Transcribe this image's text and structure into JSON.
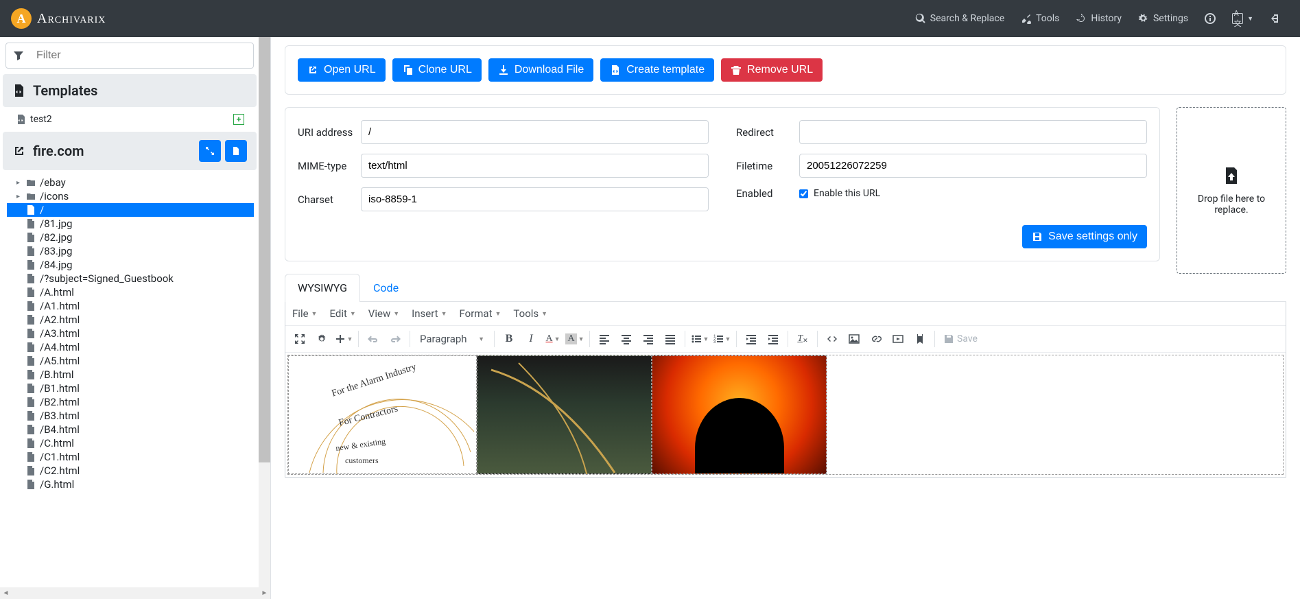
{
  "brand": {
    "name": "Archivarix",
    "logo_letter": "A"
  },
  "nav": {
    "search": "Search & Replace",
    "tools": "Tools",
    "history": "History",
    "settings": "Settings"
  },
  "sidebar": {
    "filter_placeholder": "Filter",
    "templates_header": "Templates",
    "template_items": [
      "test2"
    ],
    "site_header": "fire.com",
    "tree": [
      {
        "type": "folder",
        "label": "/ebay",
        "caret": true
      },
      {
        "type": "folder",
        "label": "/icons",
        "caret": true
      },
      {
        "type": "file",
        "label": "/",
        "selected": true
      },
      {
        "type": "file",
        "label": "/81.jpg"
      },
      {
        "type": "file",
        "label": "/82.jpg"
      },
      {
        "type": "file",
        "label": "/83.jpg"
      },
      {
        "type": "file",
        "label": "/84.jpg"
      },
      {
        "type": "file",
        "label": "/?subject=Signed_Guestbook"
      },
      {
        "type": "file",
        "label": "/A.html"
      },
      {
        "type": "file",
        "label": "/A1.html"
      },
      {
        "type": "file",
        "label": "/A2.html"
      },
      {
        "type": "file",
        "label": "/A3.html"
      },
      {
        "type": "file",
        "label": "/A4.html"
      },
      {
        "type": "file",
        "label": "/A5.html"
      },
      {
        "type": "file",
        "label": "/B.html"
      },
      {
        "type": "file",
        "label": "/B1.html"
      },
      {
        "type": "file",
        "label": "/B2.html"
      },
      {
        "type": "file",
        "label": "/B3.html"
      },
      {
        "type": "file",
        "label": "/B4.html"
      },
      {
        "type": "file",
        "label": "/C.html"
      },
      {
        "type": "file",
        "label": "/C1.html"
      },
      {
        "type": "file",
        "label": "/C2.html"
      },
      {
        "type": "file",
        "label": "/G.html"
      }
    ]
  },
  "actions": {
    "open": "Open URL",
    "clone": "Clone URL",
    "download": "Download File",
    "create_tmpl": "Create template",
    "remove": "Remove URL"
  },
  "form": {
    "uri_label": "URI address",
    "uri_value": "/",
    "mime_label": "MIME-type",
    "mime_value": "text/html",
    "charset_label": "Charset",
    "charset_value": "iso-8859-1",
    "redirect_label": "Redirect",
    "redirect_value": "",
    "filetime_label": "Filetime",
    "filetime_value": "20051226072259",
    "enabled_label": "Enabled",
    "enable_text": "Enable this URL",
    "enable_checked": true,
    "save_btn": "Save settings only"
  },
  "dropzone": {
    "text": "Drop file here to replace."
  },
  "tabs": {
    "wysiwyg": "WYSIWYG",
    "code": "Code"
  },
  "editor": {
    "menu": {
      "file": "File",
      "edit": "Edit",
      "view": "View",
      "insert": "Insert",
      "format": "Format",
      "tools": "Tools"
    },
    "para": "Paragraph",
    "save": "Save",
    "curved_text": {
      "line1": "For the Alarm Industry",
      "line2": "For Contractors",
      "line3": "new & existing",
      "line4": "customers"
    }
  }
}
